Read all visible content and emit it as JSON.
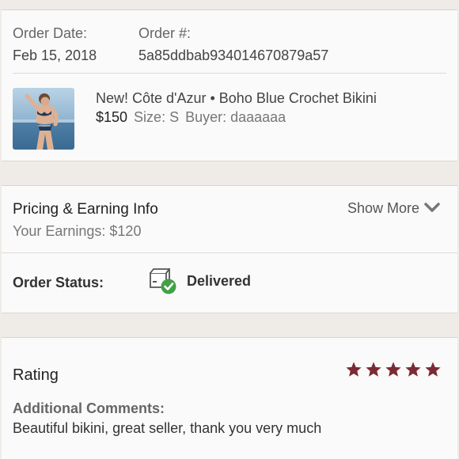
{
  "order": {
    "date_label": "Order Date:",
    "date_value": "Feb 15, 2018",
    "number_label": "Order #:",
    "number_value": "5a85ddbab934014670879a57"
  },
  "item": {
    "title": "New! Côte d'Azur • Boho Blue Crochet Bikini",
    "price": "$150",
    "size": "Size: S",
    "buyer": "Buyer: daaaaaa"
  },
  "pricing": {
    "title": "Pricing & Earning Info",
    "earnings": "Your Earnings: $120",
    "show_more": "Show More"
  },
  "status": {
    "label": "Order Status:",
    "value": "Delivered",
    "icon": "package-delivered-icon"
  },
  "rating": {
    "title": "Rating",
    "stars": 5,
    "star_color": "#7a2b35",
    "comments_label": "Additional Comments:",
    "comments_text": "Beautiful bikini, great seller, thank you very much"
  }
}
